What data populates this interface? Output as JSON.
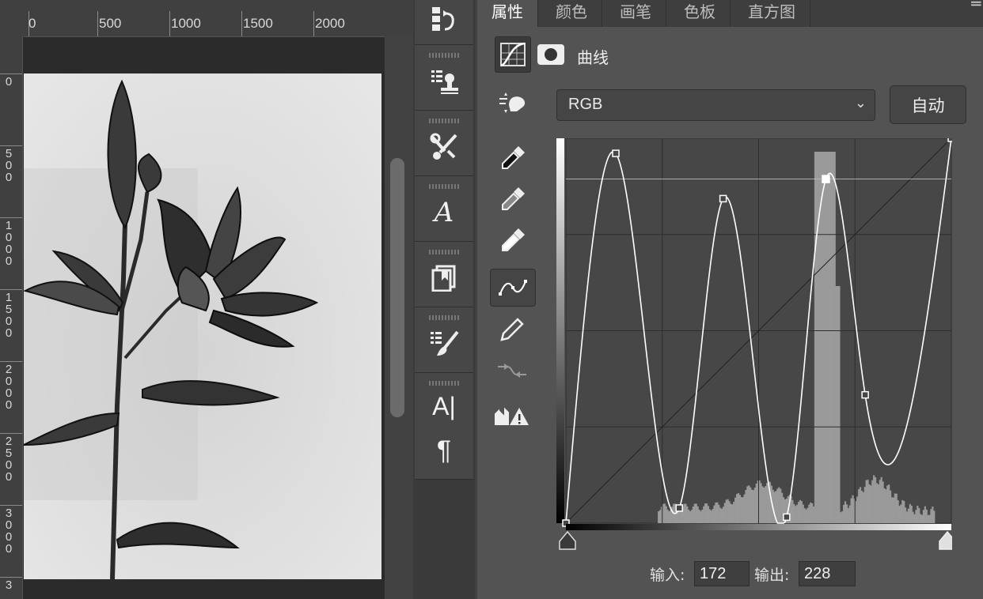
{
  "canvas": {
    "ruler_top_labels": [
      "0",
      "500",
      "1000",
      "1500",
      "2000"
    ],
    "ruler_left_labels": [
      "0",
      "500",
      "1000",
      "1500",
      "2000",
      "2500",
      "3000",
      "3"
    ]
  },
  "toolstrip": {
    "tools": [
      {
        "icon": "history-icon"
      },
      {
        "icon": "clone-source-icon"
      },
      {
        "icon": "tool-presets-icon"
      },
      {
        "icon": "glyphs-icon"
      },
      {
        "icon": "libraries-icon"
      },
      {
        "icon": "brush-settings-icon"
      },
      {
        "icon": "character-icon",
        "glyph": "A|"
      },
      {
        "icon": "paragraph-icon",
        "glyph": "¶"
      }
    ]
  },
  "properties": {
    "tabs": [
      {
        "label": "属性",
        "active": true
      },
      {
        "label": "颜色",
        "active": false
      },
      {
        "label": "画笔",
        "active": false
      },
      {
        "label": "色板",
        "active": false
      },
      {
        "label": "直方图",
        "active": false
      }
    ],
    "panel_title": "曲线",
    "channel_value": "RGB",
    "auto_label": "自动",
    "input_label": "输入:",
    "input_value": "172",
    "output_label": "输出:",
    "output_value": "228",
    "side_tools": [
      "targeted-adjustment-icon",
      "black-eyedropper-icon",
      "gray-eyedropper-icon",
      "white-eyedropper-icon",
      "curve-edit-icon",
      "pencil-icon",
      "smooth-icon",
      "clipping-warning-icon"
    ]
  },
  "curve": {
    "points": [
      {
        "input": 0,
        "output": 0
      },
      {
        "input": 33,
        "output": 245
      },
      {
        "input": 75,
        "output": 10
      },
      {
        "input": 104,
        "output": 215
      },
      {
        "input": 146,
        "output": 4
      },
      {
        "input": 172,
        "output": 228
      },
      {
        "input": 198,
        "output": 85
      },
      {
        "input": 255,
        "output": 255
      }
    ],
    "selected_index": 5,
    "colors": {
      "background": "#474747",
      "histogram": "#9a9a9a",
      "curve": "#ffffff",
      "grid": "#2e2e2e"
    }
  }
}
